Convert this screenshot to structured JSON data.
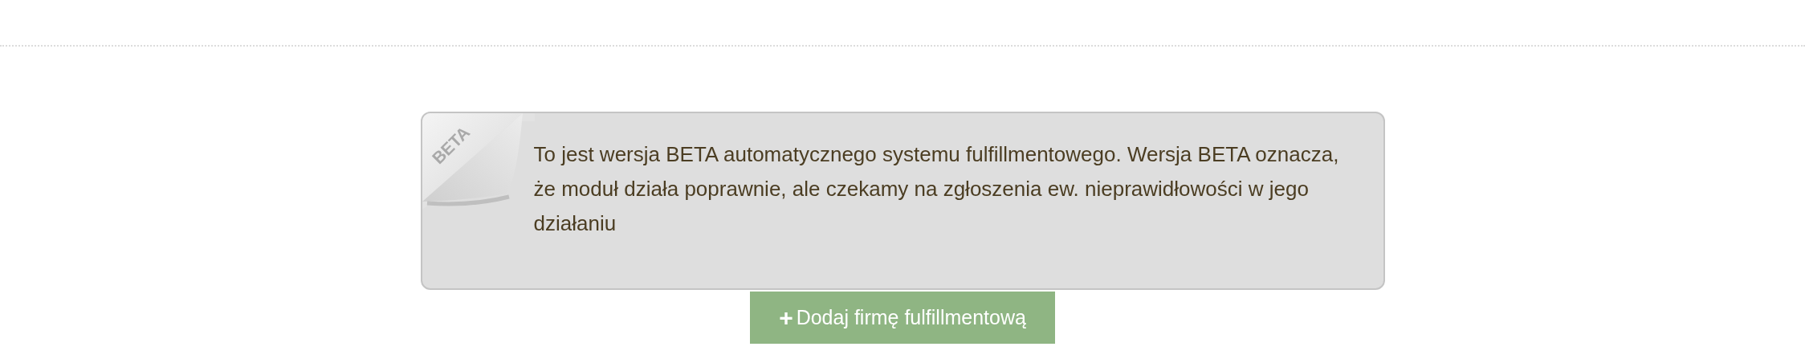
{
  "notice": {
    "badge": "BETA",
    "text": "To jest wersja BETA automatycznego systemu fulfillmentowego. Wersja BETA oznacza, że moduł działa poprawnie, ale czekamy na zgłoszenia ew. nieprawidłowości w jego działaniu"
  },
  "add_button": {
    "icon": "+",
    "label": "Dodaj firmę fulfillmentową"
  }
}
